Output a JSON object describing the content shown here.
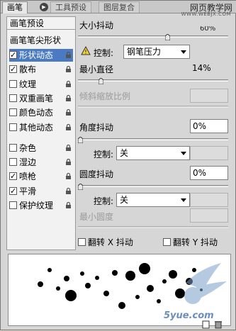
{
  "tabs": [
    {
      "label": "画笔"
    },
    {
      "label": "工具预设"
    },
    {
      "label": "图层复合"
    }
  ],
  "watermark": {
    "line1": "网页教学网",
    "line2": "WWW.WEBJX.COM",
    "bottom": "5yue.com"
  },
  "list": {
    "preset_header": "画笔预设",
    "tip_shape": "画笔笔尖形状",
    "items": [
      {
        "label": "形状动态",
        "checked": true,
        "selected": true
      },
      {
        "label": "散布",
        "checked": true,
        "selected": false
      },
      {
        "label": "纹理",
        "checked": false,
        "selected": false
      },
      {
        "label": "双重画笔",
        "checked": false,
        "selected": false
      },
      {
        "label": "颜色动态",
        "checked": false,
        "selected": false
      },
      {
        "label": "其他动态",
        "checked": false,
        "selected": false
      },
      {
        "label": "杂色",
        "checked": false,
        "selected": false
      },
      {
        "label": "湿边",
        "checked": false,
        "selected": false
      },
      {
        "label": "喷枪",
        "checked": true,
        "selected": false
      },
      {
        "label": "平滑",
        "checked": true,
        "selected": false
      },
      {
        "label": "保护纹理",
        "checked": false,
        "selected": false
      }
    ]
  },
  "settings": {
    "size_jitter_label": "大小抖动",
    "size_jitter_value": "60%",
    "size_jitter_level": 60,
    "control_label": "控制:",
    "control1_value": "钢笔压力",
    "min_diameter_label": "最小直径",
    "min_diameter_value": "14%",
    "min_diameter_level": 14,
    "tilt_scale_label": "倾斜缩放比例",
    "angle_jitter_label": "角度抖动",
    "angle_jitter_value": "0%",
    "angle_jitter_level": 0,
    "control2_value": "关",
    "roundness_jitter_label": "圆度抖动",
    "roundness_jitter_value": "0%",
    "roundness_jitter_level": 0,
    "control3_value": "关",
    "min_roundness_label": "最小圆度",
    "flip_x_label": "翻转 X 抖动",
    "flip_y_label": "翻转 Y 抖动"
  },
  "colors": {
    "selected": "#4a7bc2",
    "panel": "#d6d6d6"
  }
}
